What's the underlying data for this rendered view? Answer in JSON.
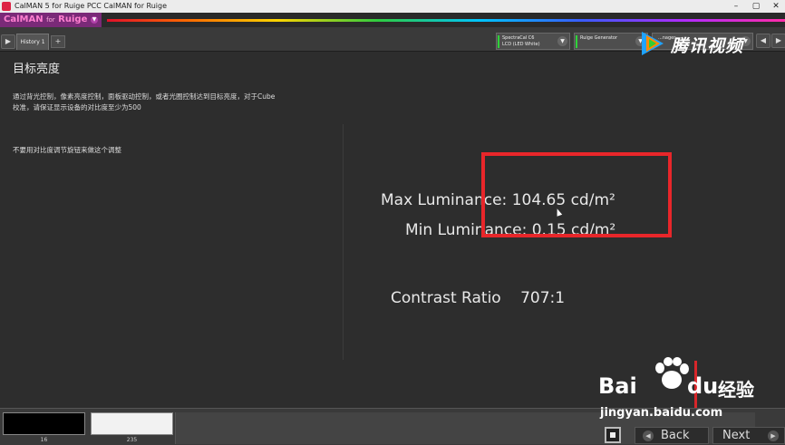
{
  "window": {
    "title": "CalMAN 5 for Ruige PCC CalMAN for Ruige",
    "controls": [
      "–",
      "▢",
      "✕"
    ]
  },
  "brand": {
    "name": "CalMAN",
    "for": "for",
    "product": "Ruige"
  },
  "tabs": {
    "history_label": "History 1",
    "add_label": "+"
  },
  "devices": [
    {
      "line1": "SpectraCal C6",
      "line2": "LCD (LED White)"
    },
    {
      "line1": "Ruige Generator",
      "line2": ""
    },
    {
      "line1": "...nager",
      "line2": ""
    }
  ],
  "page": {
    "heading": "目标亮度",
    "description": "通过背光控制，像素亮度控制，面板驱动控制，或者光圈控制达到目标亮度，对于Cube校准，请保证显示设备的对比度至少为500",
    "note": "不要用对比度调节旋钮来做这个调整"
  },
  "metrics": {
    "max_label": "Max Luminance:",
    "max_value": "104.65 cd/m²",
    "min_label": "Min Luminance:",
    "min_value": "0.15 cd/m²",
    "contrast_label": "Contrast Ratio",
    "contrast_value": "707:1"
  },
  "swatches": [
    {
      "label": "16",
      "color": "#000000"
    },
    {
      "label": "235",
      "color": "#f2f2f2"
    }
  ],
  "nav": {
    "back_label": "Back",
    "next_label": "Next"
  },
  "watermarks": {
    "tencent": "腾讯视频",
    "baidu_bai": "Bai",
    "baidu_du": "du",
    "baidu_jingyan": "经验",
    "baidu_url": "jingyan.baidu.com"
  },
  "colors": {
    "highlight": "#e8262a",
    "accent_green": "#2fd23a",
    "brand_magenta": "#7a2a78"
  }
}
